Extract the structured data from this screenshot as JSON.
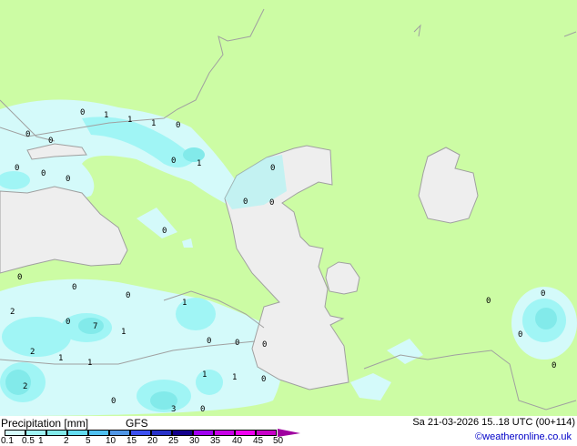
{
  "title": "Precipitation [mm]",
  "model": "GFS",
  "datetime": "Sa 21-03-2026 15..18 UTC (00+114)",
  "credit": "©weatheronline.co.uk",
  "legend": {
    "ticks": [
      "0.1",
      "0.5",
      "1",
      "2",
      "5",
      "10",
      "15",
      "20",
      "25",
      "30",
      "35",
      "40",
      "45",
      "50"
    ],
    "colors": [
      "#d4fafa",
      "#a0f5f5",
      "#82eaea",
      "#64dcf0",
      "#50c0f0",
      "#5096e6",
      "#3c50f0",
      "#2832c8",
      "#14008c",
      "#a000f0",
      "#c800e6",
      "#f000f0",
      "#c800c8"
    ]
  },
  "colors": {
    "land": "#ccfca4",
    "water": "#eeeeee",
    "border": "#a0a0a0"
  },
  "map_labels": [
    "0",
    "1",
    "1",
    "1",
    "0",
    "0",
    "0",
    "0",
    "1",
    "0",
    "0",
    "0",
    "0",
    "0",
    "0",
    "0",
    "0",
    "0",
    "0",
    "2",
    "1",
    "7",
    "1",
    "0",
    "2",
    "1",
    "1",
    "0",
    "0",
    "0",
    "1",
    "1",
    "0",
    "3",
    "0",
    "0",
    "0",
    "0",
    "0",
    "0",
    "2"
  ]
}
